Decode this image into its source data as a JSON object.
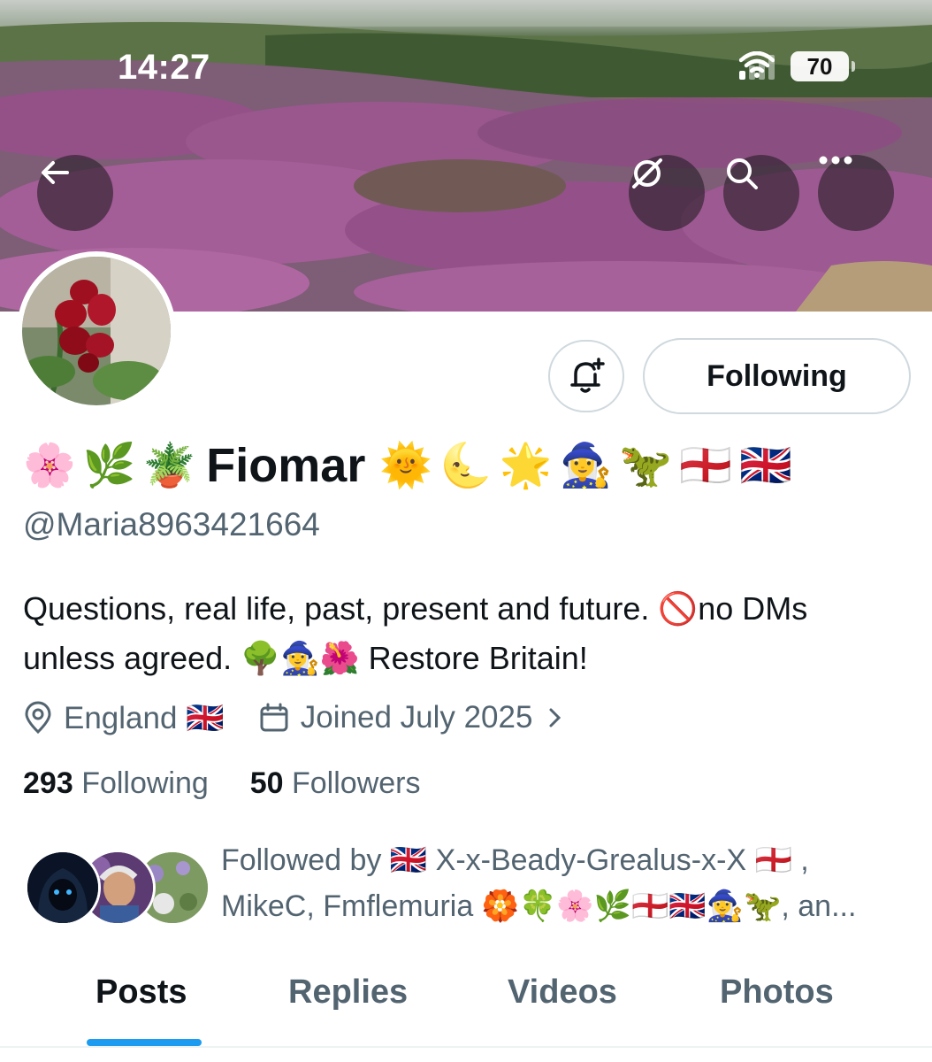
{
  "status_bar": {
    "time": "14:27",
    "battery": "70"
  },
  "header": {
    "back_icon": "arrow-left-icon",
    "grok_icon": "slashed-circle-icon",
    "search_icon": "search-icon",
    "more_icon": "more-dots-icon"
  },
  "profile": {
    "name_prefix_emojis": [
      "🌸",
      "🌿",
      "🪴"
    ],
    "display_name": "Fiomar",
    "name_suffix_emojis": [
      "🌞",
      "🌜",
      "🌟",
      "🧙‍♀️",
      "🦖",
      "🏴󠁧󠁢󠁥󠁮󠁧󠁿",
      "🇬🇧"
    ],
    "handle": "@Maria8963421664",
    "bio": {
      "line1": "Questions, real life, past, present and future. 🚫no DMs",
      "line2": "unless agreed. 🌳🧙‍♀️🌺 Restore Britain!"
    },
    "location": "England 🇬🇧",
    "joined": "Joined July 2025",
    "following_count": "293",
    "following_label": "Following",
    "followers_count": "50",
    "followers_label": "Followers"
  },
  "actions": {
    "notify_icon": "bell-plus-icon",
    "follow_state_label": "Following"
  },
  "followed_by": {
    "line1": "Followed by 🇬🇧 X-x-Beady-Grealus-x-X 🏴󠁧󠁢󠁥󠁮󠁧󠁿 ,",
    "line2": "MikeC, Fmflemuria 🏵️🍀🌸🌿🏴󠁧󠁢󠁥󠁮󠁧󠁿🇬🇧🧙‍♀️🦖, an..."
  },
  "tabs": [
    {
      "label": "Posts",
      "active": true
    },
    {
      "label": "Replies",
      "active": false
    },
    {
      "label": "Videos",
      "active": false
    },
    {
      "label": "Photos",
      "active": false
    }
  ],
  "colors": {
    "accent": "#1d9bf0",
    "text_secondary": "#536471",
    "border": "#cfd9de"
  }
}
